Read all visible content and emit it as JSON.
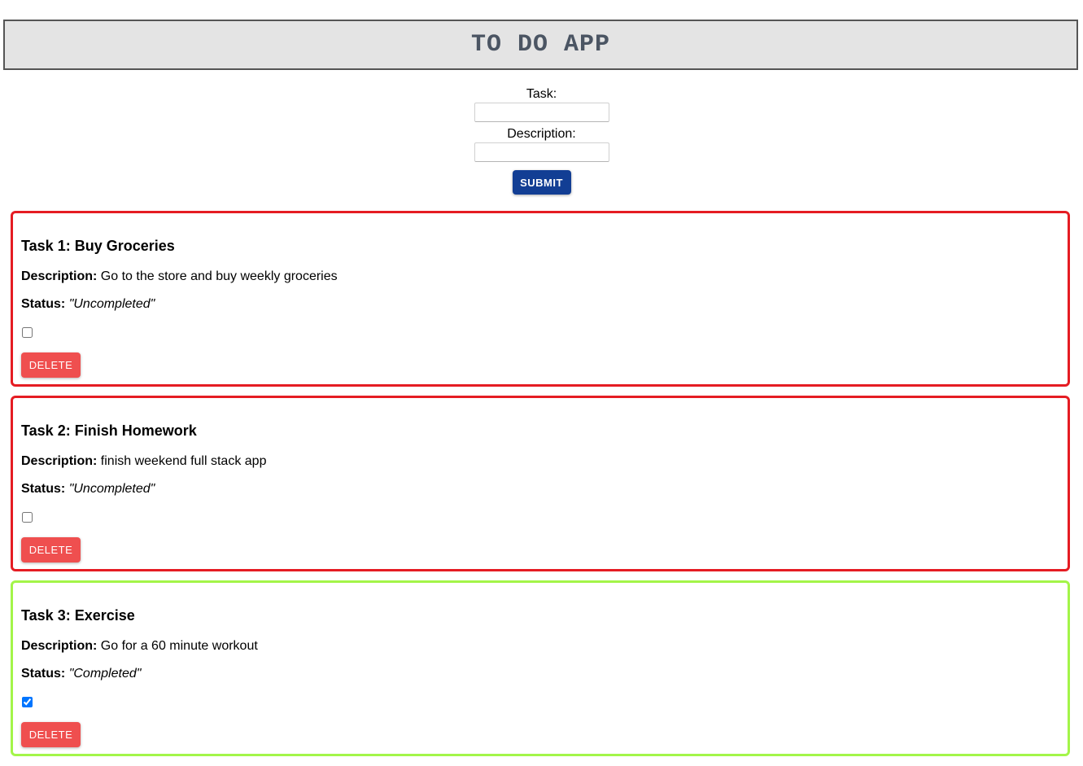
{
  "header": {
    "title": "TO DO APP"
  },
  "form": {
    "task_label": "Task:",
    "task_value": "",
    "description_label": "Description:",
    "description_value": "",
    "submit_label": "SUBMIT"
  },
  "labels": {
    "description": "Description:",
    "status": "Status:",
    "delete": "DELETE"
  },
  "tasks": [
    {
      "title": "Task 1: Buy Groceries",
      "description": "Go to the store and buy weekly groceries",
      "status": "\"Uncompleted\"",
      "completed": false
    },
    {
      "title": "Task 2: Finish Homework",
      "description": "finish weekend full stack app",
      "status": "\"Uncompleted\"",
      "completed": false
    },
    {
      "title": "Task 3: Exercise",
      "description": "Go for a 60 minute workout",
      "status": "\"Completed\"",
      "completed": true
    }
  ],
  "colors": {
    "header_bg": "#e4e4e4",
    "header_text": "#4b5563",
    "submit_bg": "#123e94",
    "delete_bg": "#ef4f4f",
    "uncompleted_border": "#e51c23",
    "completed_border": "#a3f549"
  }
}
